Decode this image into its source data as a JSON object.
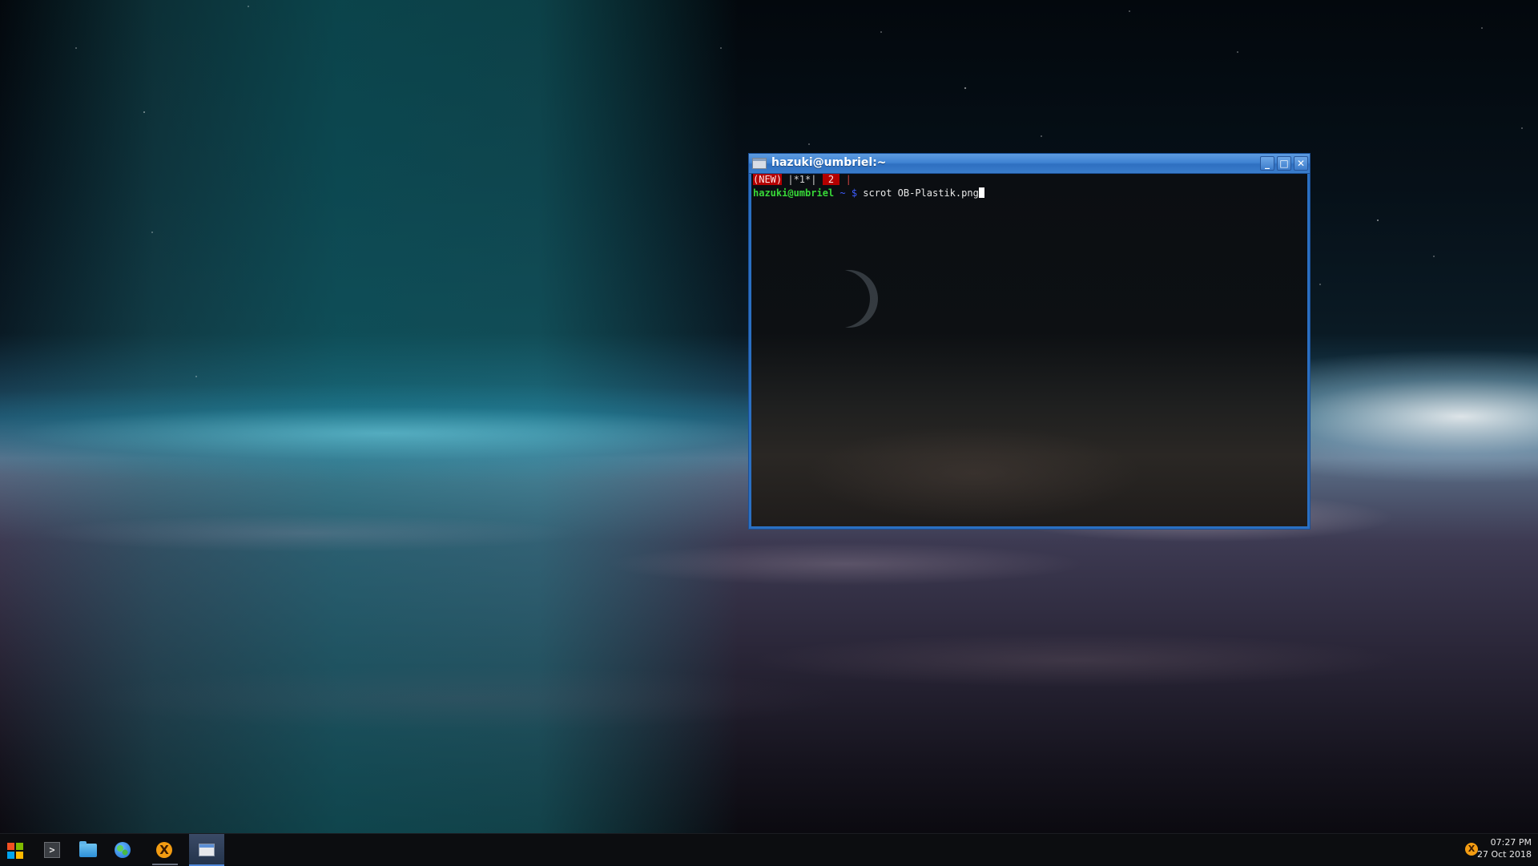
{
  "window": {
    "title": "hazuki@umbriel:~",
    "minimize_label": "_",
    "maximize_label": "□",
    "close_label": "✕"
  },
  "terminal": {
    "status": {
      "new_tag": "(NEW)",
      "window_list": " |*1*| ",
      "count_tag": " 2 ",
      "end_bar": " |"
    },
    "prompt": {
      "user_host": "hazuki@umbriel",
      "path": " ~ ",
      "symbol": "$ ",
      "command": "scrot OB-Plastik.png"
    }
  },
  "taskbar": {
    "items": [
      {
        "name": "start-menu",
        "icon": "windows-logo-icon"
      },
      {
        "name": "terminal-launcher",
        "icon": "terminal-icon",
        "label": ">"
      },
      {
        "name": "file-manager",
        "icon": "folder-icon"
      },
      {
        "name": "web-browser",
        "icon": "globe-icon"
      },
      {
        "name": "x-app",
        "icon": "x-circle-icon",
        "label": "X"
      },
      {
        "name": "terminal-window-task",
        "icon": "window-icon"
      }
    ],
    "tray_icon_label": "X",
    "clock": {
      "time": "07:27 PM",
      "date": "27 Oct 2018"
    }
  },
  "colors": {
    "titlebar": "#3f83d3",
    "prompt_user": "#38d838",
    "prompt_path": "#3d5cff",
    "status_tag": "#b40000"
  }
}
